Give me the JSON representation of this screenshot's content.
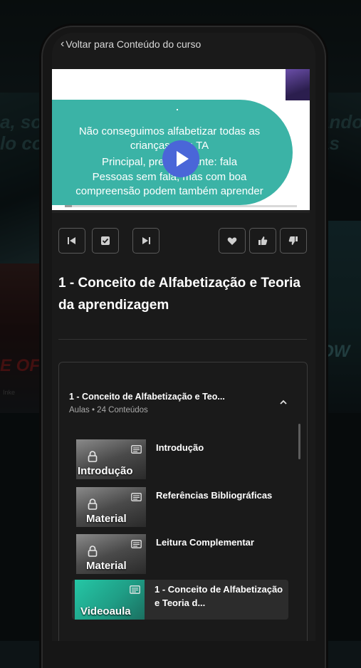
{
  "background": {
    "left_line1": "a, som",
    "left_line2": "lo co",
    "right_line1": "ando",
    "right_line2": "as",
    "red_text": "E OF",
    "right_text2": "OW",
    "small_text": "Inke"
  },
  "nav": {
    "back_label": "Voltar para Conteúdo do curso"
  },
  "video": {
    "slide_lines": [
      "Não conseguimos alfabetizar todas as",
      "crianças com TA",
      "Principal, predominante: fala",
      "Pessoas sem fala, mas com boa",
      "compreensão podem também aprender"
    ],
    "progress": 0.03
  },
  "lesson": {
    "title": "1 - Conceito de Alfabetização e Teoria da aprendizagem"
  },
  "module": {
    "title": "1 - Conceito de Alfabetização e Teo...",
    "subtitle": "Aulas • 24 Conteúdos",
    "items": [
      {
        "thumb_label": "Introdução",
        "title": "Introdução",
        "locked": true
      },
      {
        "thumb_label": "Material",
        "title": "Referências Bibliográficas",
        "locked": true
      },
      {
        "thumb_label": "Material",
        "title": "Leitura Complementar",
        "locked": true
      },
      {
        "thumb_label": "Videoaula",
        "title": "1 - Conceito de Alfabetização e Teoria d...",
        "locked": false,
        "active": true
      }
    ]
  },
  "colors": {
    "accent_blue": "#4a66d8",
    "slide_teal": "#3bb3a6",
    "surface": "#1a1a1a"
  }
}
